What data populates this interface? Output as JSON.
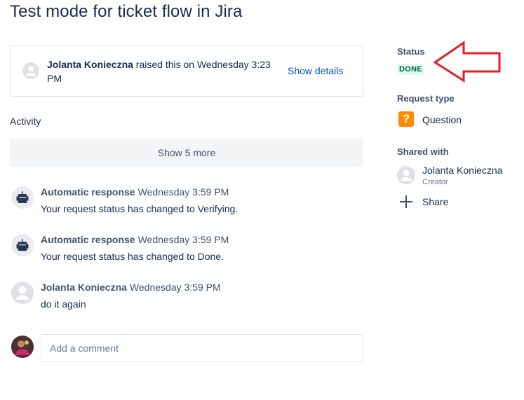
{
  "request": {
    "title": "Test mode for ticket flow in Jira",
    "raised_by": "Jolanta Konieczna",
    "raised_suffix": " raised this on Wednesday 3:23 PM",
    "show_details": "Show details"
  },
  "activity": {
    "heading": "Activity",
    "show_more": "Show 5 more",
    "items": [
      {
        "author": "Automatic response",
        "time": "Wednesday 3:59 PM",
        "text": "Your request status has changed to Verifying.",
        "avatar": "robot-icon"
      },
      {
        "author": "Automatic response",
        "time": "Wednesday 3:59 PM",
        "text": "Your request status has changed to Done.",
        "avatar": "robot-icon"
      },
      {
        "author": "Jolanta Konieczna",
        "time": "Wednesday 3:59 PM",
        "text": "do it again",
        "avatar": "user-avatar-icon"
      }
    ]
  },
  "comment": {
    "placeholder": "Add a comment"
  },
  "sidebar": {
    "status_label": "Status",
    "status_value": "DONE",
    "request_type_label": "Request type",
    "request_type_value": "Question",
    "request_type_icon": "question-icon",
    "shared_with_label": "Shared with",
    "shared_name": "Jolanta Konieczna",
    "shared_role": "Creator",
    "share_button": "Share"
  },
  "colors": {
    "accent_link": "#0052cc",
    "status_bg": "#e3fcef",
    "status_text": "#006644",
    "annotation_arrow": "#e31e24",
    "question_icon": "#ff8b00"
  }
}
